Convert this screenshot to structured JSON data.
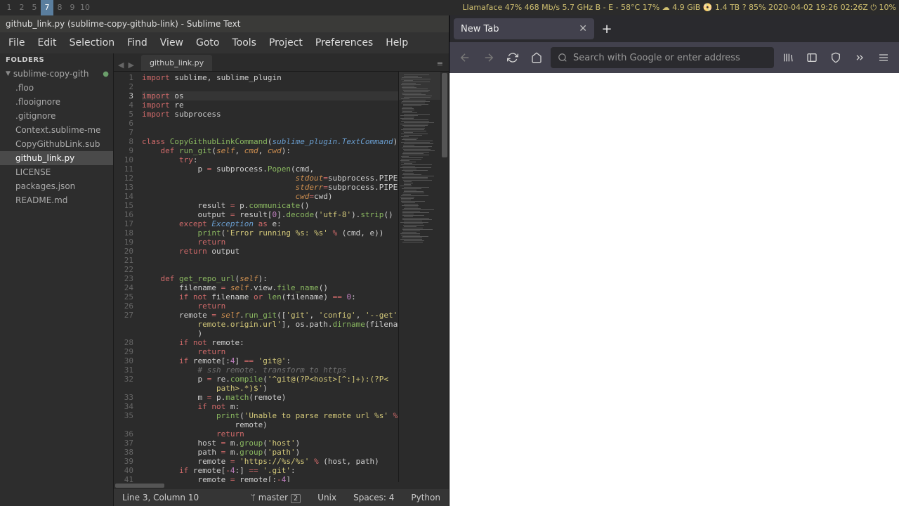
{
  "sysbar": {
    "workspaces": [
      "1",
      "2",
      "5",
      "7",
      "8",
      "9",
      "10"
    ],
    "active_ws_index": 3,
    "status": "Llamaface 47% 468 Mb/s 5.7 GHz B - E - 58°C 17% ☁ 4.9 GiB 📀 1.4 TB ? 85% 2020-04-02 19:26 02:26Z ⏻ 10%"
  },
  "sublime": {
    "title": "github_link.py (sublime-copy-github-link) - Sublime Text",
    "menu": [
      "File",
      "Edit",
      "Selection",
      "Find",
      "View",
      "Goto",
      "Tools",
      "Project",
      "Preferences",
      "Help"
    ],
    "sidebar": {
      "header": "FOLDERS",
      "root": "sublime-copy-gith",
      "items": [
        {
          "label": ".floo"
        },
        {
          "label": ".flooignore"
        },
        {
          "label": ".gitignore"
        },
        {
          "label": "Context.sublime-me"
        },
        {
          "label": "CopyGithubLink.sub"
        },
        {
          "label": "github_link.py",
          "active": true
        },
        {
          "label": "LICENSE"
        },
        {
          "label": "packages.json"
        },
        {
          "label": "README.md"
        }
      ]
    },
    "tab": "github_link.py",
    "status": {
      "pos": "Line 3, Column 10",
      "branch": "master",
      "branch_badge": "2",
      "encoding": "Unix",
      "indent": "Spaces: 4",
      "syntax": "Python"
    },
    "code": [
      {
        "n": 1,
        "t": "import",
        "r": " sublime, sublime_plugin"
      },
      {
        "n": 2,
        "t": "",
        "r": ""
      },
      {
        "n": 3,
        "t": "import",
        "r": " os",
        "cur": true
      },
      {
        "n": 4,
        "t": "import",
        "r": " re"
      },
      {
        "n": 5,
        "t": "import",
        "r": " subprocess"
      },
      {
        "n": 6,
        "t": "",
        "r": ""
      },
      {
        "n": 7,
        "t": "",
        "r": ""
      },
      {
        "n": 8,
        "raw": "<span class='kw'>class</span> <span class='fn'>CopyGithubLinkCommand</span>(<span class='kw2'>sublime_plugin.TextCommand</span>):"
      },
      {
        "n": 9,
        "raw": "    <span class='kw'>def</span> <span class='fn'>run_git</span>(<span class='param'>self</span>, <span class='param'>cmd</span>, <span class='param'>cwd</span>):"
      },
      {
        "n": 10,
        "raw": "        <span class='kw'>try</span>:"
      },
      {
        "n": 11,
        "raw": "            p <span class='op'>=</span> subprocess.<span class='fn'>Popen</span>(cmd,"
      },
      {
        "n": 12,
        "raw": "                                 <span class='param'>stdout</span><span class='op'>=</span>subprocess.PIPE,"
      },
      {
        "n": 13,
        "raw": "                                 <span class='param'>stderr</span><span class='op'>=</span>subprocess.PIPE,"
      },
      {
        "n": 14,
        "raw": "                                 <span class='param'>cwd</span><span class='op'>=</span>cwd)"
      },
      {
        "n": 15,
        "raw": "            result <span class='op'>=</span> p.<span class='fn'>communicate</span>()"
      },
      {
        "n": 16,
        "raw": "            output <span class='op'>=</span> result[<span class='num'>0</span>].<span class='fn'>decode</span>(<span class='str'>'utf-8'</span>).<span class='fn'>strip</span>()"
      },
      {
        "n": 17,
        "raw": "        <span class='kw'>except</span> <span class='kw2'>Exception</span> <span class='kw'>as</span> e:"
      },
      {
        "n": 18,
        "raw": "            <span class='fn'>print</span>(<span class='str'>'Error running %s: %s'</span> <span class='op'>%</span> (cmd, e))"
      },
      {
        "n": 19,
        "raw": "            <span class='kw'>return</span>"
      },
      {
        "n": 20,
        "raw": "        <span class='kw'>return</span> output"
      },
      {
        "n": 21,
        "raw": ""
      },
      {
        "n": 22,
        "raw": ""
      },
      {
        "n": 23,
        "raw": "    <span class='kw'>def</span> <span class='fn'>get_repo_url</span>(<span class='param'>self</span>):"
      },
      {
        "n": 24,
        "raw": "        filename <span class='op'>=</span> <span class='param'>self</span>.view.<span class='fn'>file_name</span>()"
      },
      {
        "n": 25,
        "raw": "        <span class='kw'>if</span> <span class='kw'>not</span> filename <span class='kw'>or</span> <span class='fn'>len</span>(filename) <span class='op'>==</span> <span class='num'>0</span>:"
      },
      {
        "n": 26,
        "raw": "            <span class='kw'>return</span>"
      },
      {
        "n": 27,
        "raw": "        remote <span class='op'>=</span> <span class='param'>self</span>.<span class='fn'>run_git</span>([<span class='str'>'git'</span>, <span class='str'>'config'</span>, <span class='str'>'--get'</span>, <span class='str'>'</span>"
      },
      {
        "n": 0,
        "raw": "            <span class='str'>remote.origin.url'</span>], os.path.<span class='fn'>dirname</span>(filename)"
      },
      {
        "n": 0,
        "raw": "            )"
      },
      {
        "n": 28,
        "raw": "        <span class='kw'>if</span> <span class='kw'>not</span> remote:"
      },
      {
        "n": 29,
        "raw": "            <span class='kw'>return</span>"
      },
      {
        "n": 30,
        "raw": "        <span class='kw'>if</span> remote[:<span class='num'>4</span>] <span class='op'>==</span> <span class='str'>'git@'</span>:"
      },
      {
        "n": 31,
        "raw": "            <span class='cmt'># ssh remote. transform to https</span>"
      },
      {
        "n": 32,
        "raw": "            p <span class='op'>=</span> re.<span class='fn'>compile</span>(<span class='str'>'^git@(?P&lt;host&gt;[^:]+):(?P&lt;</span>"
      },
      {
        "n": 0,
        "raw": "                <span class='str'>path&gt;.*)$'</span>)"
      },
      {
        "n": 33,
        "raw": "            m <span class='op'>=</span> p.<span class='fn'>match</span>(remote)"
      },
      {
        "n": 34,
        "raw": "            <span class='kw'>if</span> <span class='kw'>not</span> m:"
      },
      {
        "n": 35,
        "raw": "                <span class='fn'>print</span>(<span class='str'>'Unable to parse remote url %s'</span> <span class='op'>%</span>"
      },
      {
        "n": 0,
        "raw": "                    remote)"
      },
      {
        "n": 36,
        "raw": "                <span class='kw'>return</span>"
      },
      {
        "n": 37,
        "raw": "            host <span class='op'>=</span> m.<span class='fn'>group</span>(<span class='str'>'host'</span>)"
      },
      {
        "n": 38,
        "raw": "            path <span class='op'>=</span> m.<span class='fn'>group</span>(<span class='str'>'path'</span>)"
      },
      {
        "n": 39,
        "raw": "            remote <span class='op'>=</span> <span class='str'>'https://%s/%s'</span> <span class='op'>%</span> (host, path)"
      },
      {
        "n": 40,
        "raw": "        <span class='kw'>if</span> remote[<span class='op'>-</span><span class='num'>4</span>:] <span class='op'>==</span> <span class='str'>'.git'</span>:"
      },
      {
        "n": 41,
        "raw": "            remote <span class='op'>=</span> remote[:<span class='op'>-</span><span class='num'>4</span>]"
      }
    ]
  },
  "browser": {
    "tab_label": "New Tab",
    "url_placeholder": "Search with Google or enter address"
  }
}
